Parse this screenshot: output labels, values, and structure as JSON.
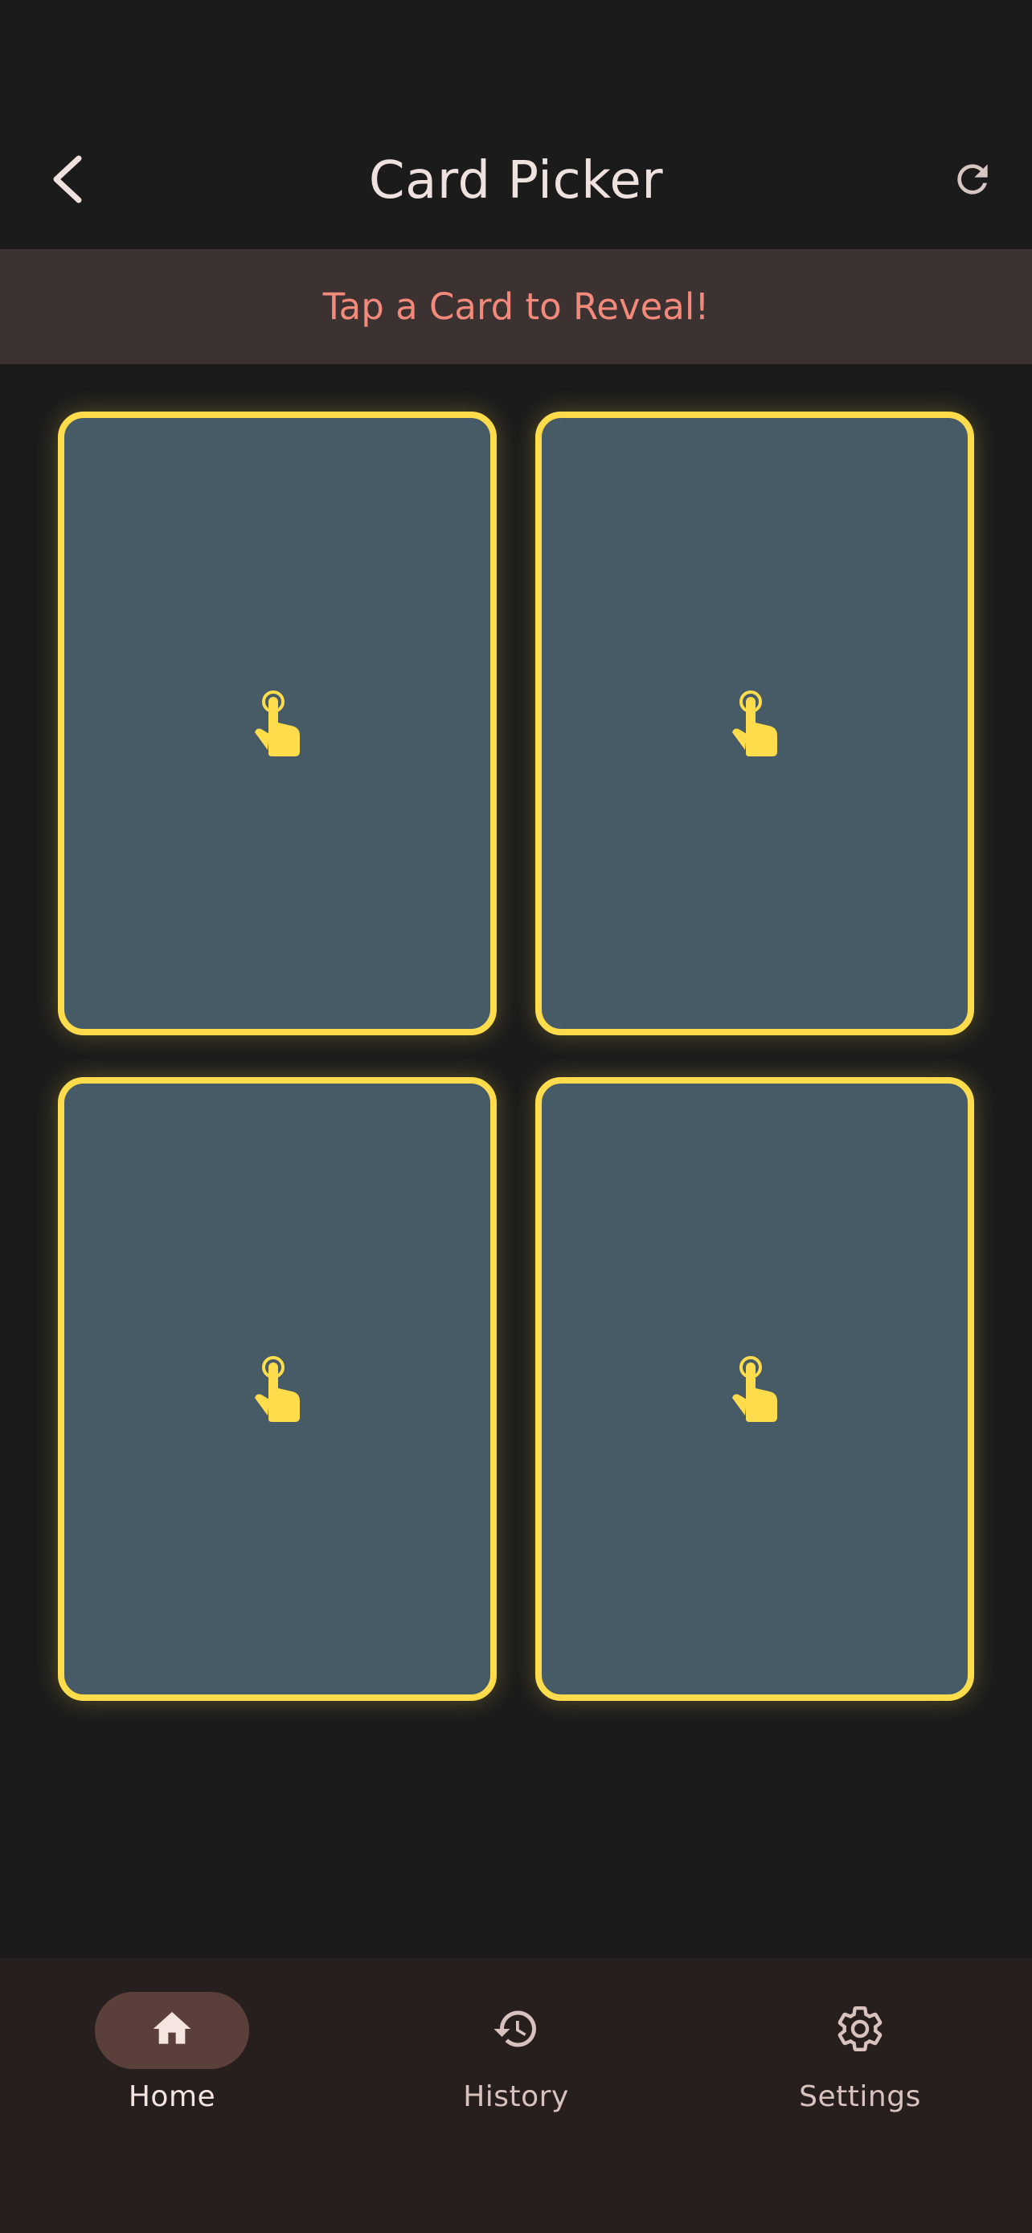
{
  "app_bar": {
    "title": "Card Picker",
    "back_icon": "chevron-left-icon",
    "refresh_icon": "refresh-icon"
  },
  "banner": {
    "text": "Tap a Card to Reveal!"
  },
  "cards": [
    {
      "icon": "tap-hand-icon"
    },
    {
      "icon": "tap-hand-icon"
    },
    {
      "icon": "tap-hand-icon"
    },
    {
      "icon": "tap-hand-icon"
    }
  ],
  "bottom_nav": {
    "items": [
      {
        "label": "Home",
        "icon": "home-icon",
        "active": true
      },
      {
        "label": "History",
        "icon": "history-icon",
        "active": false
      },
      {
        "label": "Settings",
        "icon": "gear-icon",
        "active": false
      }
    ]
  },
  "colors": {
    "background": "#1b1b1b",
    "banner_bg": "#3c3232",
    "banner_text": "#f3897a",
    "card_fill": "#475b66",
    "card_border": "#fedc4c",
    "nav_bg": "#271e1e",
    "nav_active_pill": "#5b3f3b"
  }
}
